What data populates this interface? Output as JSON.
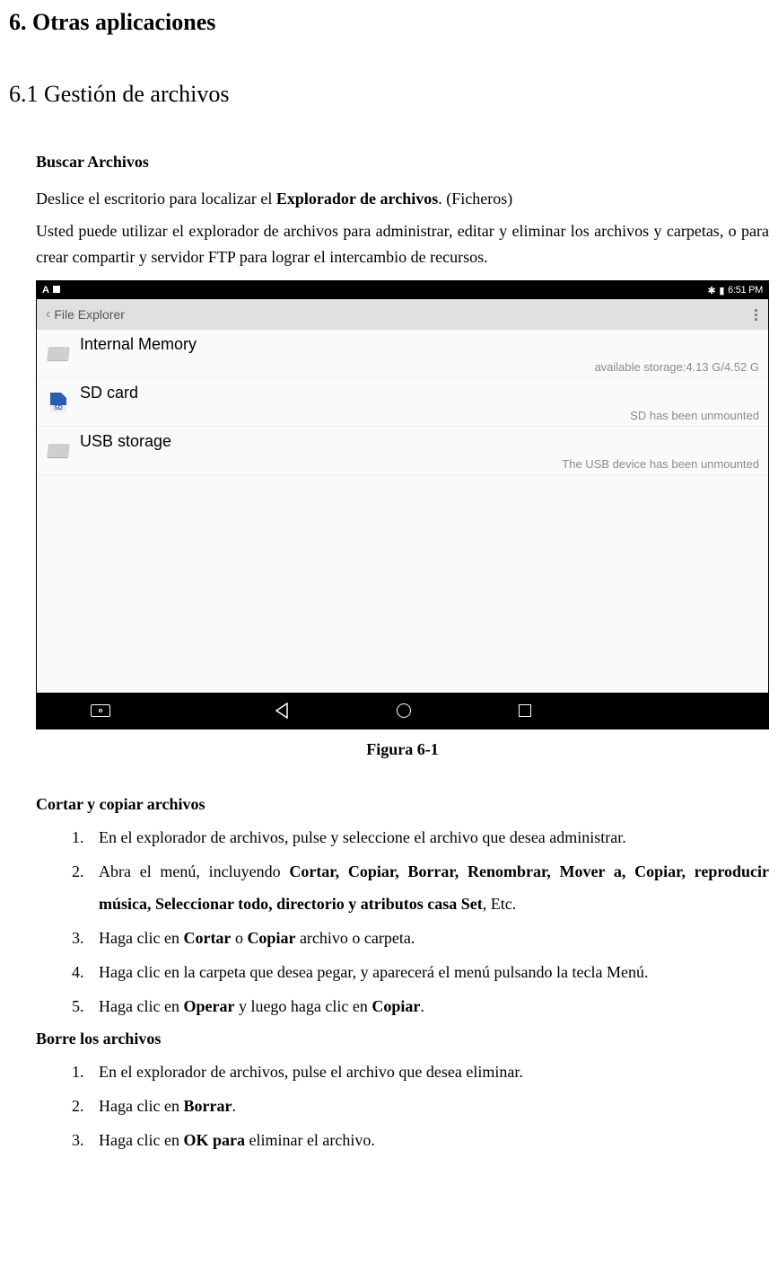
{
  "heading6": "6. Otras aplicaciones",
  "heading61": "6.1 Gestión de archivos",
  "section1": {
    "title": "Buscar Archivos",
    "para1a": "Deslice el escritorio para localizar el ",
    "para1b": "Explorador de archivos",
    "para1c": ". (Ficheros)",
    "para2": "Usted puede utilizar el explorador de archivos para administrar, editar y eliminar los archivos y carpetas, o para crear compartir y servidor FTP para lograr el intercambio de recursos."
  },
  "figcap": "Figura 6-1",
  "screenshot": {
    "status": {
      "left_icons": [
        "warning",
        "image"
      ],
      "time": "6:51 PM",
      "right_icons": [
        "bluetooth",
        "battery"
      ]
    },
    "title": "File Explorer",
    "items": [
      {
        "name": "Internal Memory",
        "sub": "available storage:4.13 G/4.52 G",
        "icon": "folder"
      },
      {
        "name": "SD card",
        "sub": "SD has been unmounted",
        "icon": "sd"
      },
      {
        "name": "USB storage",
        "sub": "The USB device has been unmounted",
        "icon": "folder"
      }
    ]
  },
  "section2": {
    "title": "Cortar y copiar archivos",
    "items": [
      {
        "pre": "En el explorador de archivos, pulse y seleccione el archivo que desea administrar."
      },
      {
        "pre": "Abra el menú, incluyendo ",
        "bold": "Cortar, Copiar, Borrar, Renombrar, Mover a, Copiar, reproducir música, Seleccionar todo, directorio y atributos casa Set",
        "post": ", Etc."
      },
      {
        "pre": "Haga clic en ",
        "bold": "Cortar",
        "mid": " o ",
        "bold2": "Copiar",
        "post": " archivo o carpeta."
      },
      {
        "pre": "Haga clic en la carpeta que desea pegar, y aparecerá el menú pulsando la tecla Menú."
      },
      {
        "pre": "Haga clic en ",
        "bold": "Operar",
        "mid": " y luego haga clic en ",
        "bold2": "Copiar",
        "post": "."
      }
    ]
  },
  "section3": {
    "title": "Borre los archivos",
    "items": [
      {
        "pre": "En el explorador de archivos, pulse el archivo que desea eliminar."
      },
      {
        "pre": "Haga clic en ",
        "bold": "Borrar",
        "post": "."
      },
      {
        "pre": "Haga clic en ",
        "bold": "OK para",
        "post": " eliminar el archivo."
      }
    ]
  }
}
